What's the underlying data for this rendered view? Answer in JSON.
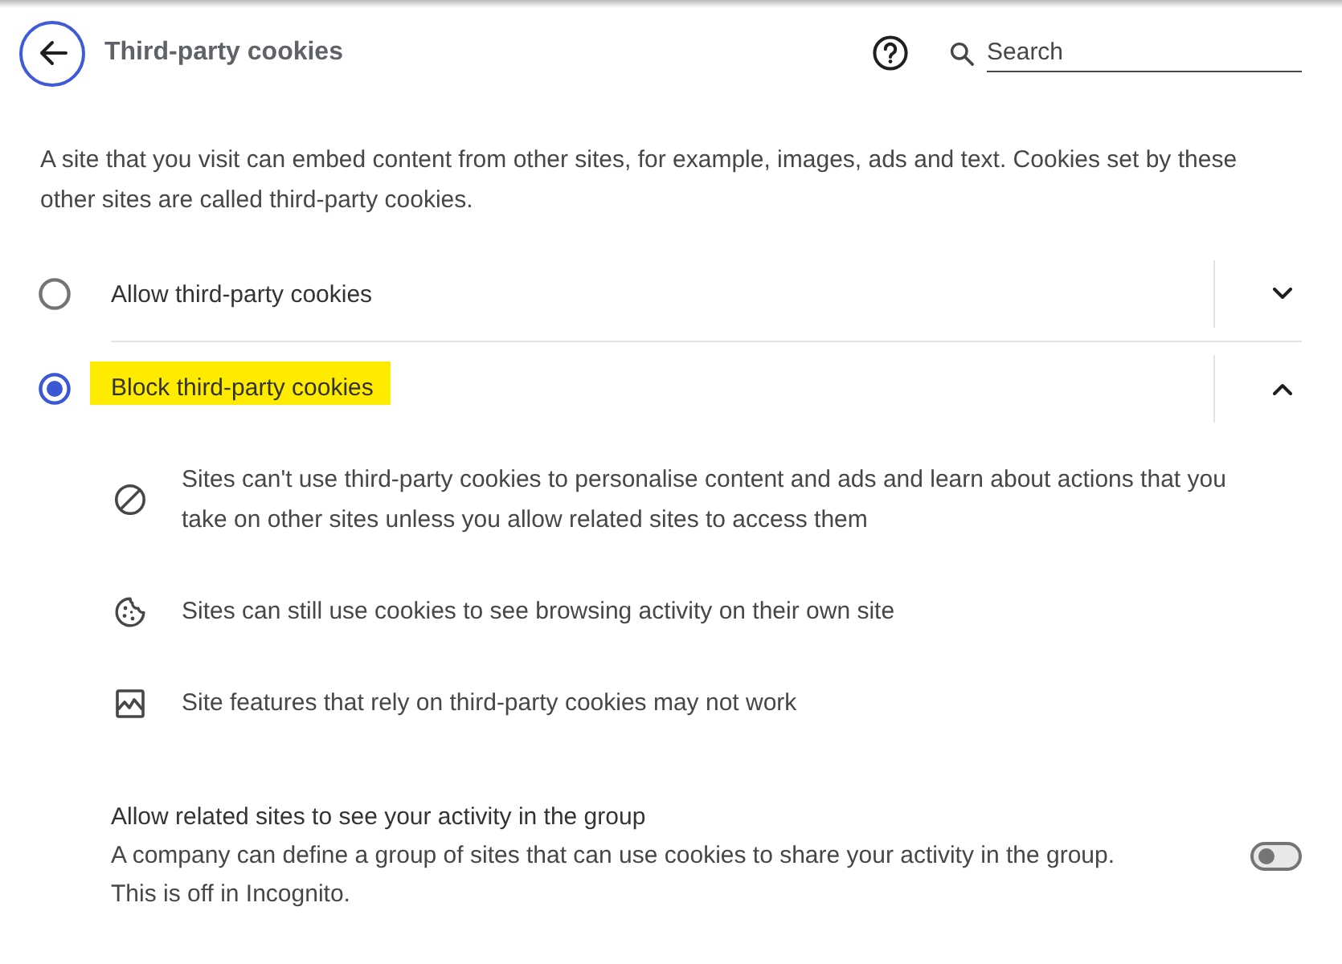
{
  "header": {
    "title": "Third-party cookies",
    "search": {
      "placeholder": "Search"
    }
  },
  "description": "A site that you visit can embed content from other sites, for example, images, ads and text. Cookies set by these other sites are called third-party cookies.",
  "options": [
    {
      "label": "Allow third-party cookies",
      "selected": false,
      "expanded": false,
      "highlighted": false
    },
    {
      "label": "Block third-party cookies",
      "selected": true,
      "expanded": true,
      "highlighted": true,
      "details": [
        {
          "kind": "blocked",
          "text": "Sites can't use third-party cookies to personalise content and ads and learn about actions that you take on other sites unless you allow related sites to access them"
        },
        {
          "kind": "cookie",
          "text": "Sites can still use cookies to see browsing activity on their own site"
        },
        {
          "kind": "image",
          "text": "Site features that rely on third-party cookies may not work"
        }
      ]
    }
  ],
  "related_sites": {
    "title": "Allow related sites to see your activity in the group",
    "description": "A company can define a group of sites that can use cookies to share your activity in the group. This is off in Incognito.",
    "on": false
  }
}
